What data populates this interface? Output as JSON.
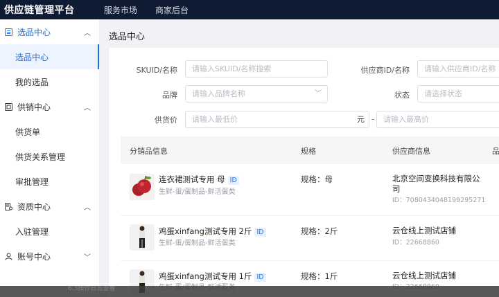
{
  "app": {
    "title": "供应链管理平台",
    "nav": [
      "服务市场",
      "商家后台"
    ]
  },
  "sidebar": {
    "groups": [
      {
        "label": "选品中心",
        "icon": "list-icon",
        "expanded": true,
        "items": [
          "选品中心",
          "我的选品"
        ]
      },
      {
        "label": "供销中心",
        "icon": "document-icon",
        "expanded": true,
        "items": [
          "供货单",
          "供货关系管理",
          "审批管理"
        ]
      },
      {
        "label": "资质中心",
        "icon": "certificate-icon",
        "expanded": true,
        "items": [
          "入驻管理"
        ]
      },
      {
        "label": "账号中心",
        "icon": "user-icon",
        "expanded": false,
        "items": []
      }
    ],
    "active_item": "选品中心"
  },
  "page": {
    "title": "选品中心"
  },
  "filters": {
    "skuid": {
      "label": "SKUID/名称",
      "placeholder": "请输入SKUID/名称搜索"
    },
    "supplier": {
      "label": "供应商ID/名称",
      "placeholder": "请输入供应商ID/名称"
    },
    "brand": {
      "label": "品牌",
      "placeholder": "请输入品牌名称"
    },
    "status": {
      "label": "状态",
      "placeholder": "请选择状态"
    },
    "price": {
      "label": "供货价",
      "min_placeholder": "请输入最低价",
      "unit": "元",
      "separator": "-",
      "max_placeholder": "请输入最高价"
    }
  },
  "table": {
    "headers": [
      "分销品信息",
      "规格",
      "供应商信息",
      "品"
    ],
    "rows": [
      {
        "name": "连衣裙测试专用 母",
        "id_tag": "ID",
        "category": "生鲜-蛋/蛋制品-鲜活蛋类",
        "spec": "规格：母",
        "supplier_name_line1": "北京空间变换科技有限公",
        "supplier_name_line2": "司",
        "supplier_id": "ID：7080434048199295271",
        "thumb": "apple"
      },
      {
        "name": "鸡蛋xinfang测试专用 2斤",
        "id_tag": "ID",
        "category": "生鲜-蛋/蛋制品-鲜活蛋类",
        "spec": "规格：2斤",
        "supplier_name_line1": "云仓线上测试店铺",
        "supplier_name_line2": "",
        "supplier_id": "ID：22668860",
        "thumb": "person"
      },
      {
        "name": "鸡蛋xinfang测试专用 1斤",
        "id_tag": "ID",
        "category": "生鲜-蛋/蛋制品-鲜活蛋类",
        "spec": "规格：1斤",
        "supplier_name_line1": "云仓线上测试店铺",
        "supplier_name_line2": "",
        "supplier_id": "ID：22668860",
        "thumb": "person"
      }
    ]
  },
  "footer_ghost_text": "6.3操作日志查看",
  "colors": {
    "topbar": "#0f1a33",
    "accent": "#1f6fe5",
    "active_bg": "#eef4ff"
  }
}
